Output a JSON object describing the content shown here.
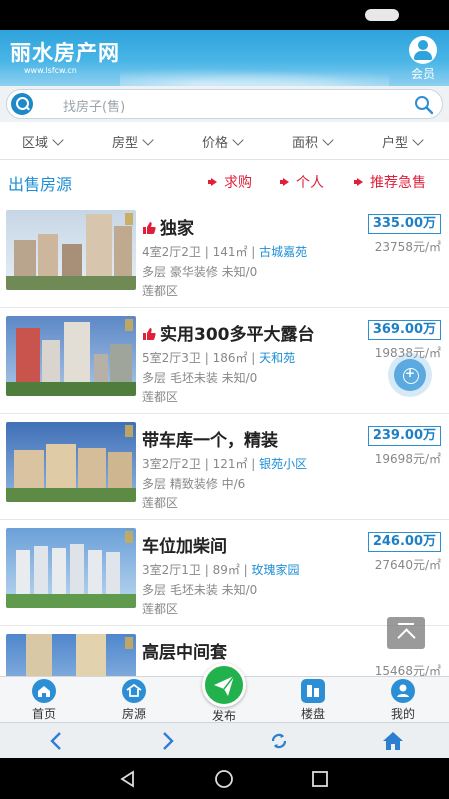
{
  "header": {
    "title": "丽水房产网",
    "url": "www.lsfcw.cn",
    "member_label": "会员"
  },
  "search": {
    "placeholder": "找房子(售)"
  },
  "filters": [
    "区域",
    "房型",
    "价格",
    "面积",
    "户型"
  ],
  "section": {
    "title": "出售房源",
    "links": [
      "求购",
      "个人",
      "推荐急售"
    ]
  },
  "listings": [
    {
      "title": "独家",
      "hot": true,
      "rooms": "4室2厅2卫",
      "area": "141㎡",
      "community": "古城嘉苑",
      "details": "多层 豪华装修 未知/0",
      "district": "莲都区",
      "price": "335.00万",
      "unit_price": "23758元/㎡"
    },
    {
      "title": "实用300多平大露台",
      "hot": true,
      "rooms": "5室2厅3卫",
      "area": "186㎡",
      "community": "天和苑",
      "details": "多层 毛坯未装 未知/0",
      "district": "莲都区",
      "price": "369.00万",
      "unit_price": "19838元/㎡"
    },
    {
      "title": "带车库一个，精装",
      "hot": false,
      "rooms": "3室2厅2卫",
      "area": "121㎡",
      "community": "银苑小区",
      "details": "多层 精致装修 中/6",
      "district": "莲都区",
      "price": "239.00万",
      "unit_price": "19698元/㎡"
    },
    {
      "title": "车位加柴间",
      "hot": false,
      "rooms": "3室2厅1卫",
      "area": "89㎡",
      "community": "玫瑰家园",
      "details": "多层 毛坯未装 未知/0",
      "district": "莲都区",
      "price": "246.00万",
      "unit_price": "27640元/㎡"
    },
    {
      "title": "高层中间套",
      "hot": false,
      "price": "",
      "unit_price": "15468元/㎡"
    }
  ],
  "tabbar": {
    "home": "首页",
    "listings": "房源",
    "publish": "发布",
    "estates": "楼盘",
    "mine": "我的"
  },
  "colors": {
    "brand_blue": "#2ea3dc",
    "link_blue": "#1d8fd6",
    "alert_red": "#e0203a",
    "publish_green": "#22b14c"
  }
}
